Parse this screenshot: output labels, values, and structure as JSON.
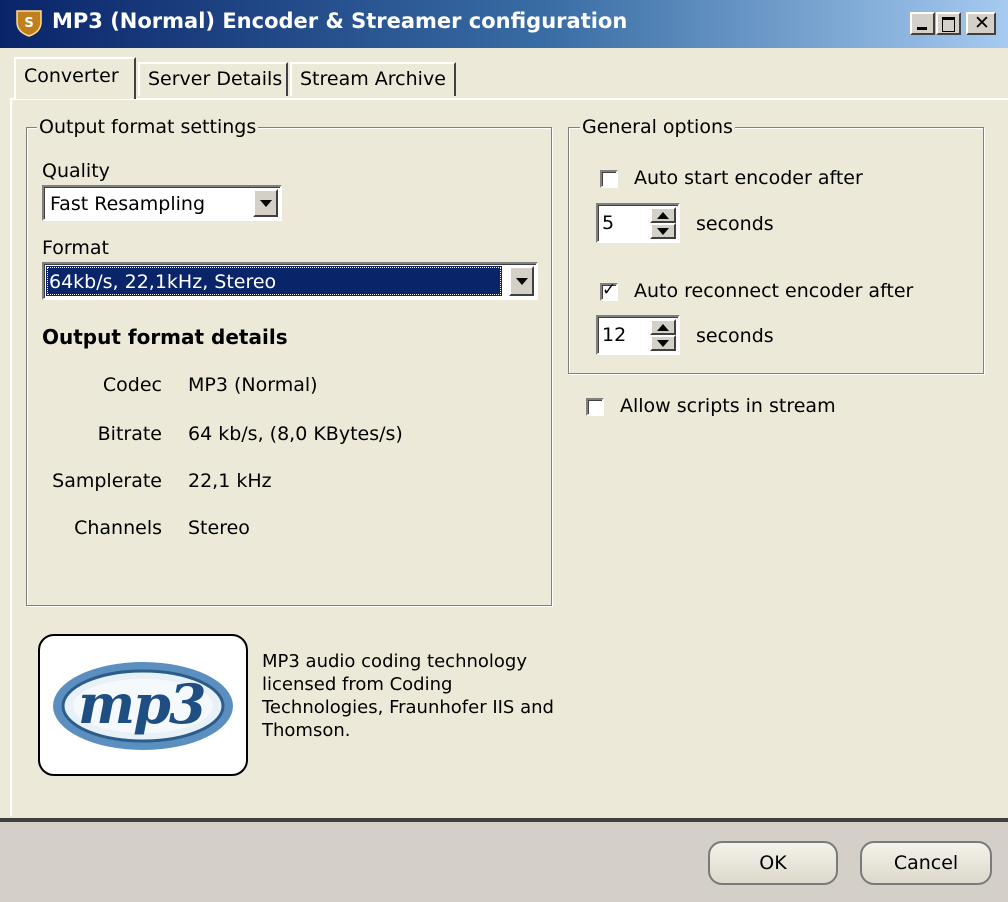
{
  "window": {
    "title": "MP3 (Normal) Encoder & Streamer configuration"
  },
  "tabs": [
    {
      "label": "Converter",
      "selected": true
    },
    {
      "label": "Server Details",
      "selected": false
    },
    {
      "label": "Stream Archive",
      "selected": false
    }
  ],
  "output_format": {
    "group_label": "Output format settings",
    "quality_label": "Quality",
    "quality_value": "Fast Resampling",
    "format_label": "Format",
    "format_value": "64kb/s, 22,1kHz, Stereo",
    "details_heading": "Output format details",
    "details": [
      {
        "label": "Codec",
        "value": "MP3 (Normal)"
      },
      {
        "label": "Bitrate",
        "value": "64 kb/s, (8,0 KBytes/s)"
      },
      {
        "label": "Samplerate",
        "value": "22,1 kHz"
      },
      {
        "label": "Channels",
        "value": "Stereo"
      }
    ]
  },
  "general_options": {
    "group_label": "General options",
    "auto_start": {
      "label": "Auto start encoder after",
      "checked": false,
      "value": "5",
      "unit": "seconds"
    },
    "auto_reconnect": {
      "label": "Auto reconnect encoder after",
      "checked": true,
      "value": "12",
      "unit": "seconds"
    }
  },
  "allow_scripts": {
    "label": "Allow scripts in stream",
    "checked": false
  },
  "logo": {
    "text": "mp3"
  },
  "license_text": "MP3 audio coding technology licensed from Coding Technologies, Fraunhofer IIS and Thomson.",
  "buttons": {
    "ok": "OK",
    "cancel": "Cancel"
  },
  "colors": {
    "title_bar": "#0a246a",
    "face": "#ece9d8",
    "selection": "#0a246a"
  }
}
